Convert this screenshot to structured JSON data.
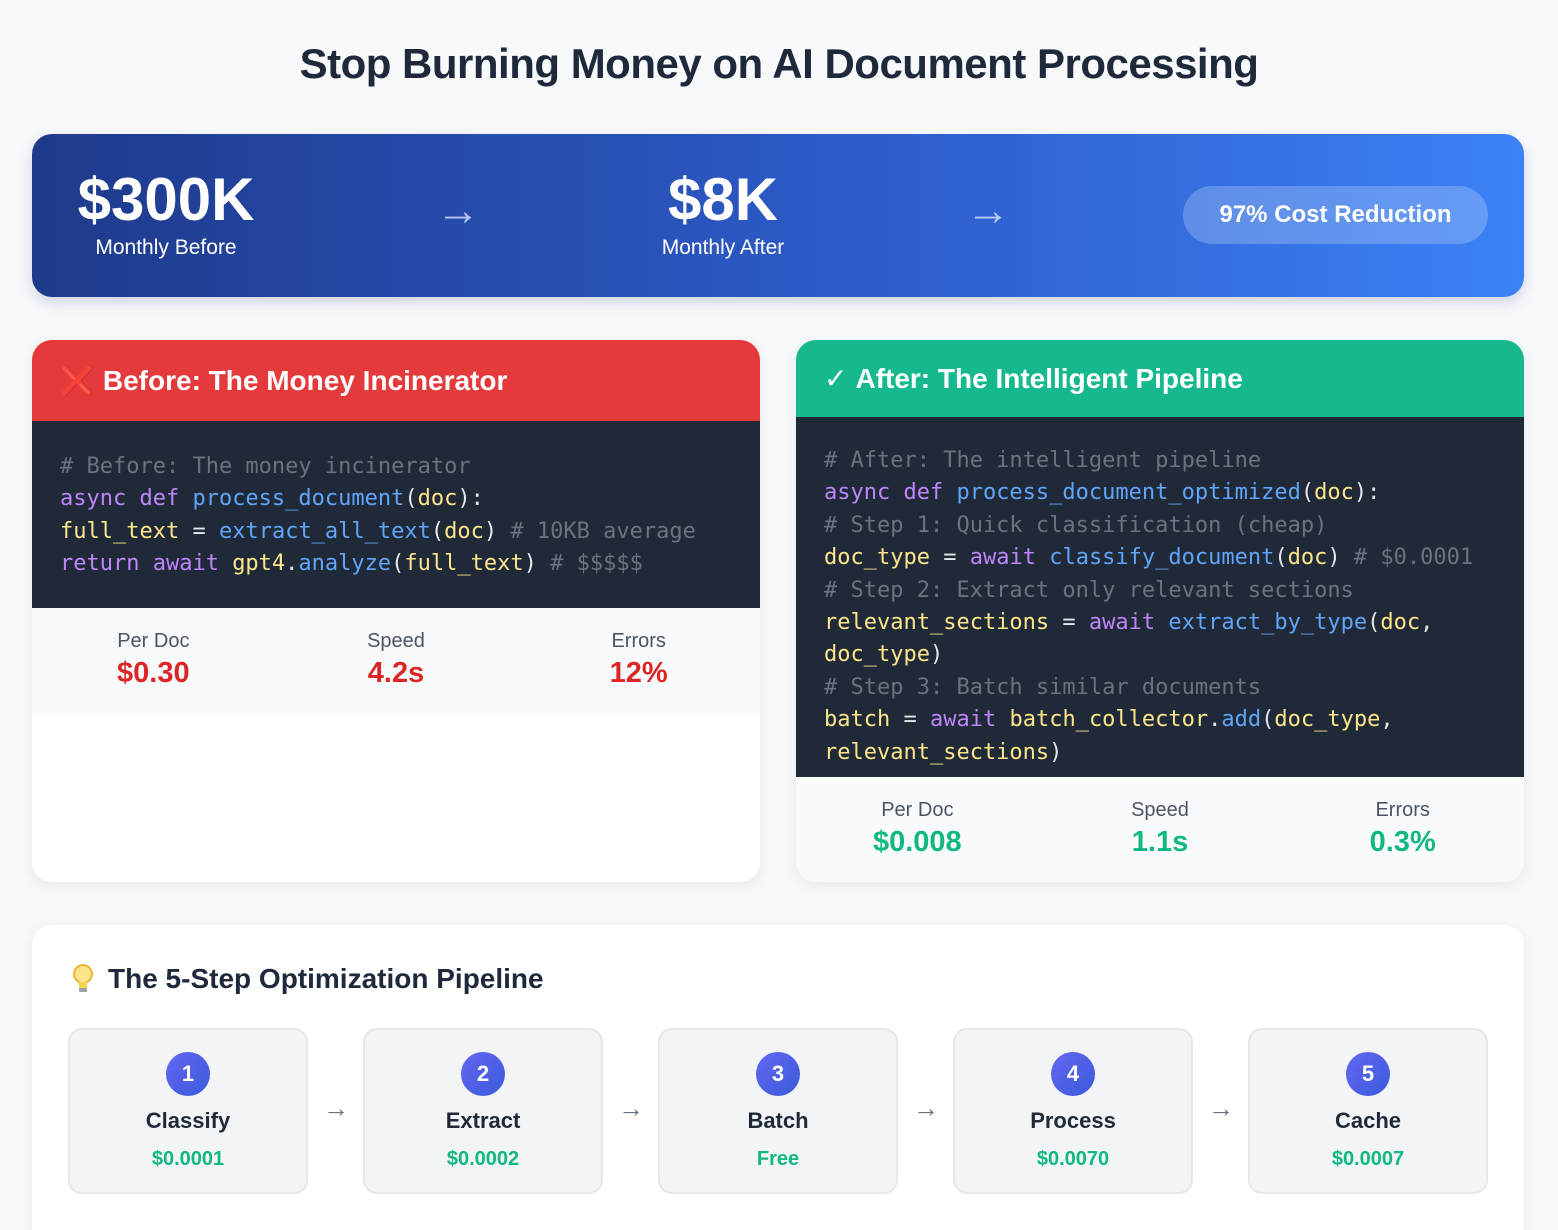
{
  "title": "Stop Burning Money on AI Document Processing",
  "hero": {
    "before_value": "$300K",
    "before_label": "Monthly Before",
    "arrow": "→",
    "after_value": "$8K",
    "after_label": "Monthly After",
    "badge": "97% Cost Reduction"
  },
  "before_card": {
    "icon": "❌",
    "title": "Before: The Money Incinerator",
    "code": [
      [
        [
          "c-cm",
          "# Before: The money incinerator"
        ]
      ],
      [
        [
          "c-kw",
          "async def "
        ],
        [
          "c-fn",
          "process_document"
        ],
        [
          "c-pl",
          "("
        ],
        [
          "c-id",
          "doc"
        ],
        [
          "c-pl",
          "):"
        ]
      ],
      [
        [
          "c-id",
          "full_text"
        ],
        [
          "c-pl",
          " = "
        ],
        [
          "c-fn",
          "extract_all_text"
        ],
        [
          "c-pl",
          "("
        ],
        [
          "c-id",
          "doc"
        ],
        [
          "c-pl",
          ") "
        ],
        [
          "c-cm",
          "# 10KB average"
        ]
      ],
      [
        [
          "c-kw",
          "return await "
        ],
        [
          "c-id",
          "gpt4"
        ],
        [
          "c-pl",
          "."
        ],
        [
          "c-fn",
          "analyze"
        ],
        [
          "c-pl",
          "("
        ],
        [
          "c-id",
          "full_text"
        ],
        [
          "c-pl",
          ") "
        ],
        [
          "c-cm",
          "# $$$$$"
        ]
      ]
    ],
    "metrics": [
      {
        "label": "Per Doc",
        "value": "$0.30"
      },
      {
        "label": "Speed",
        "value": "4.2s"
      },
      {
        "label": "Errors",
        "value": "12%"
      }
    ]
  },
  "after_card": {
    "icon": "✓",
    "title": "After: The Intelligent Pipeline",
    "code": [
      [
        [
          "c-cm",
          "# After: The intelligent pipeline"
        ]
      ],
      [
        [
          "c-kw",
          "async def "
        ],
        [
          "c-fn",
          "process_document_optimized"
        ],
        [
          "c-pl",
          "("
        ],
        [
          "c-id",
          "doc"
        ],
        [
          "c-pl",
          "):"
        ]
      ],
      [
        [
          "c-cm",
          "# Step 1: Quick classification (cheap)"
        ]
      ],
      [
        [
          "c-id",
          "doc_type"
        ],
        [
          "c-pl",
          " = "
        ],
        [
          "c-kw",
          "await "
        ],
        [
          "c-fn",
          "classify_document"
        ],
        [
          "c-pl",
          "("
        ],
        [
          "c-id",
          "doc"
        ],
        [
          "c-pl",
          ") "
        ],
        [
          "c-cm",
          "# $0.0001"
        ]
      ],
      [
        [
          "c-cm",
          "# Step 2: Extract only relevant sections"
        ]
      ],
      [
        [
          "c-id",
          "relevant_sections"
        ],
        [
          "c-pl",
          " = "
        ],
        [
          "c-kw",
          "await "
        ],
        [
          "c-fn",
          "extract_by_type"
        ],
        [
          "c-pl",
          "("
        ],
        [
          "c-id",
          "doc"
        ],
        [
          "c-pl",
          ","
        ]
      ],
      [
        [
          "c-id",
          "doc_type"
        ],
        [
          "c-pl",
          ")"
        ]
      ],
      [
        [
          "c-cm",
          "# Step 3: Batch similar documents"
        ]
      ],
      [
        [
          "c-id",
          "batch"
        ],
        [
          "c-pl",
          " = "
        ],
        [
          "c-kw",
          "await "
        ],
        [
          "c-id",
          "batch_collector"
        ],
        [
          "c-pl",
          "."
        ],
        [
          "c-fn",
          "add"
        ],
        [
          "c-pl",
          "("
        ],
        [
          "c-id",
          "doc_type"
        ],
        [
          "c-pl",
          ","
        ]
      ],
      [
        [
          "c-id",
          "relevant_sections"
        ],
        [
          "c-pl",
          ")"
        ]
      ]
    ],
    "metrics": [
      {
        "label": "Per Doc",
        "value": "$0.008"
      },
      {
        "label": "Speed",
        "value": "1.1s"
      },
      {
        "label": "Errors",
        "value": "0.3%"
      }
    ]
  },
  "pipeline": {
    "icon": "lightbulb-icon",
    "title": "The 5-Step Optimization Pipeline",
    "arrow": "→",
    "steps": [
      {
        "number": "1",
        "name": "Classify",
        "cost": "$0.0001"
      },
      {
        "number": "2",
        "name": "Extract",
        "cost": "$0.0002"
      },
      {
        "number": "3",
        "name": "Batch",
        "cost": "Free"
      },
      {
        "number": "4",
        "name": "Process",
        "cost": "$0.0070"
      },
      {
        "number": "5",
        "name": "Cache",
        "cost": "$0.0007"
      }
    ]
  },
  "colors": {
    "before_accent": "#e53a3c",
    "after_accent": "#16b98d",
    "hero_start": "#1e3a8a",
    "hero_end": "#3b82f6"
  }
}
